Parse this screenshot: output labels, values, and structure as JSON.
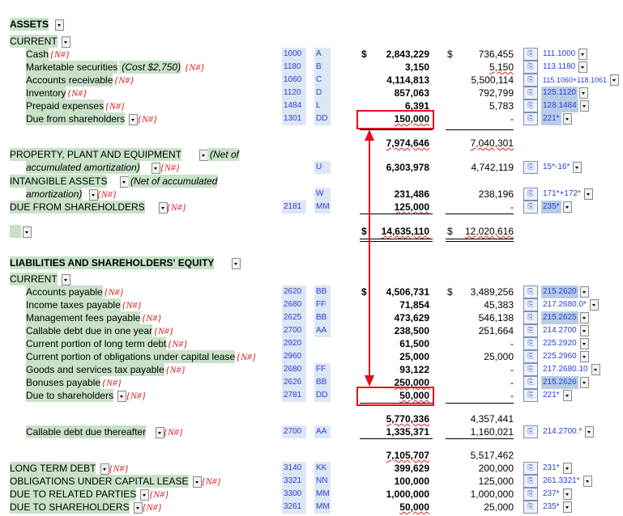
{
  "sections": {
    "assets": "ASSETS",
    "current_assets": "CURRENT",
    "ppe": "PROPERTY, PLANT AND EQUIPMENT",
    "ppe_note": "(Net of",
    "ppe_note2": "accumulated amortization)",
    "intangible": "INTANGIBLE ASSETS",
    "intangible_note": "(Net of accumulated",
    "intangible_note2": "amortization)",
    "due_from_sh": "DUE FROM SHAREHOLDERS",
    "liab_equity": "LIABILITIES AND SHAREHOLDERS' EQUITY",
    "current_liab": "CURRENT",
    "callable_thereafter": "Callable debt due thereafter",
    "ltd": "LONG TERM DEBT",
    "olcl": "OBLIGATIONS UNDER CAPITAL LEASE",
    "drp": "DUE TO RELATED PARTIES",
    "dts": "DUE TO SHAREHOLDERS"
  },
  "na": "{N#}",
  "currency": "$",
  "asset_rows": [
    {
      "label": "Cash",
      "code": "1000",
      "ref": "A",
      "v1": "2,843,229",
      "v2": "736,455",
      "formula": "111.1000",
      "dollar": true
    },
    {
      "label": "Marketable securities",
      "note": "(Cost $2,750)",
      "code": "1180",
      "ref": "B",
      "v1": "3,150",
      "v2": "5,150",
      "formula": "113.1180"
    },
    {
      "label": "Accounts receivable",
      "code": "1060",
      "ref": "C",
      "v1": "4,114,813",
      "v2": "5,500,114",
      "formula": "115.1060+118.1061"
    },
    {
      "label": "Inventory",
      "code": "1120",
      "ref": "D",
      "v1": "857,063",
      "v2": "792,799",
      "formula": "125.1120"
    },
    {
      "label": "Prepaid expenses",
      "code": "1484",
      "ref": "L",
      "v1": "6,391",
      "v2": "5,783",
      "formula": "128.1484"
    },
    {
      "label": "Due from shareholders",
      "code": "1301",
      "ref": "DD",
      "v1": "150,000",
      "v2": "-",
      "formula": "221*"
    }
  ],
  "current_assets_total": {
    "v1": "7,974,646",
    "v2": "7,040,301"
  },
  "ppe_values": {
    "ref": "U",
    "v1": "6,303,978",
    "v2": "4,742,119",
    "formula": "15*-16*"
  },
  "intangible_values": {
    "ref": "W",
    "v1": "231,486",
    "v2": "238,196",
    "formula": "171*+172*"
  },
  "due_from_sh_values": {
    "code": "2181",
    "ref": "MM",
    "v1": "125,000",
    "v2": "-",
    "formula": "235*"
  },
  "total_assets": {
    "v1": "14,635,110",
    "v2": "12,020,616"
  },
  "liab_rows": [
    {
      "label": "Accounts payable",
      "code": "2620",
      "ref": "BB",
      "v1": "4,506,731",
      "v2": "3,489,256",
      "formula": "215.2620",
      "dollar": true
    },
    {
      "label": "Income taxes payable",
      "code": "2680",
      "ref": "FF",
      "v1": "71,854",
      "v2": "45,383",
      "formula": "217.2680.0*"
    },
    {
      "label": "Management fees payable",
      "code": "2625",
      "ref": "BB",
      "v1": "473,629",
      "v2": "546,138",
      "formula": "215.2625"
    },
    {
      "label": "Callable debt due in one year",
      "code": "2700",
      "ref": "AA",
      "v1": "238,500",
      "v2": "251,664",
      "formula": "214.2700"
    },
    {
      "label": "Current portion of long term debt",
      "code": "2920",
      "ref": "",
      "v1": "61,500",
      "v2": "-",
      "formula": "225.2920"
    },
    {
      "label": "Current portion of obligations under capital lease",
      "code": "2960",
      "ref": "",
      "v1": "25,000",
      "v2": "25,000",
      "formula": "225.2960"
    },
    {
      "label": "Goods and services tax payable",
      "code": "2680",
      "ref": "FF",
      "v1": "93,122",
      "v2": "-",
      "formula": "217.2680.10"
    },
    {
      "label": "Bonuses payable",
      "code": "2626",
      "ref": "BB",
      "v1": "250,000",
      "v2": "-",
      "formula": "215.2626"
    },
    {
      "label": "Due to shareholders",
      "code": "2781",
      "ref": "DD",
      "v1": "50,000",
      "v2": "-",
      "formula": "221*"
    }
  ],
  "current_liab_total": {
    "v1": "5,770,336",
    "v2": "4,357,441"
  },
  "callable_values": {
    "code": "2700",
    "ref": "AA",
    "v1": "1,335,371",
    "v2": "1,160,021",
    "formula": "214.2700.*"
  },
  "liab_subtotal": {
    "v1": "7,105,707",
    "v2": "5,517,462"
  },
  "lt_rows": [
    {
      "key": "ltd",
      "code": "3140",
      "ref": "KK",
      "v1": "399,629",
      "v2": "200,000",
      "formula": "231*"
    },
    {
      "key": "olcl",
      "code": "3321",
      "ref": "NN",
      "v1": "100,000",
      "v2": "125,000",
      "formula": "261.3321*"
    },
    {
      "key": "drp",
      "code": "3300",
      "ref": "MM",
      "v1": "1,000,000",
      "v2": "1,000,000",
      "formula": "237*"
    },
    {
      "key": "dts",
      "code": "3261",
      "ref": "MM",
      "v1": "50,000",
      "v2": "25,000",
      "formula": "235*"
    }
  ],
  "colors": {
    "green": "#c8e2c8",
    "red": "#e0101a",
    "blue": "#2a3fd1"
  }
}
